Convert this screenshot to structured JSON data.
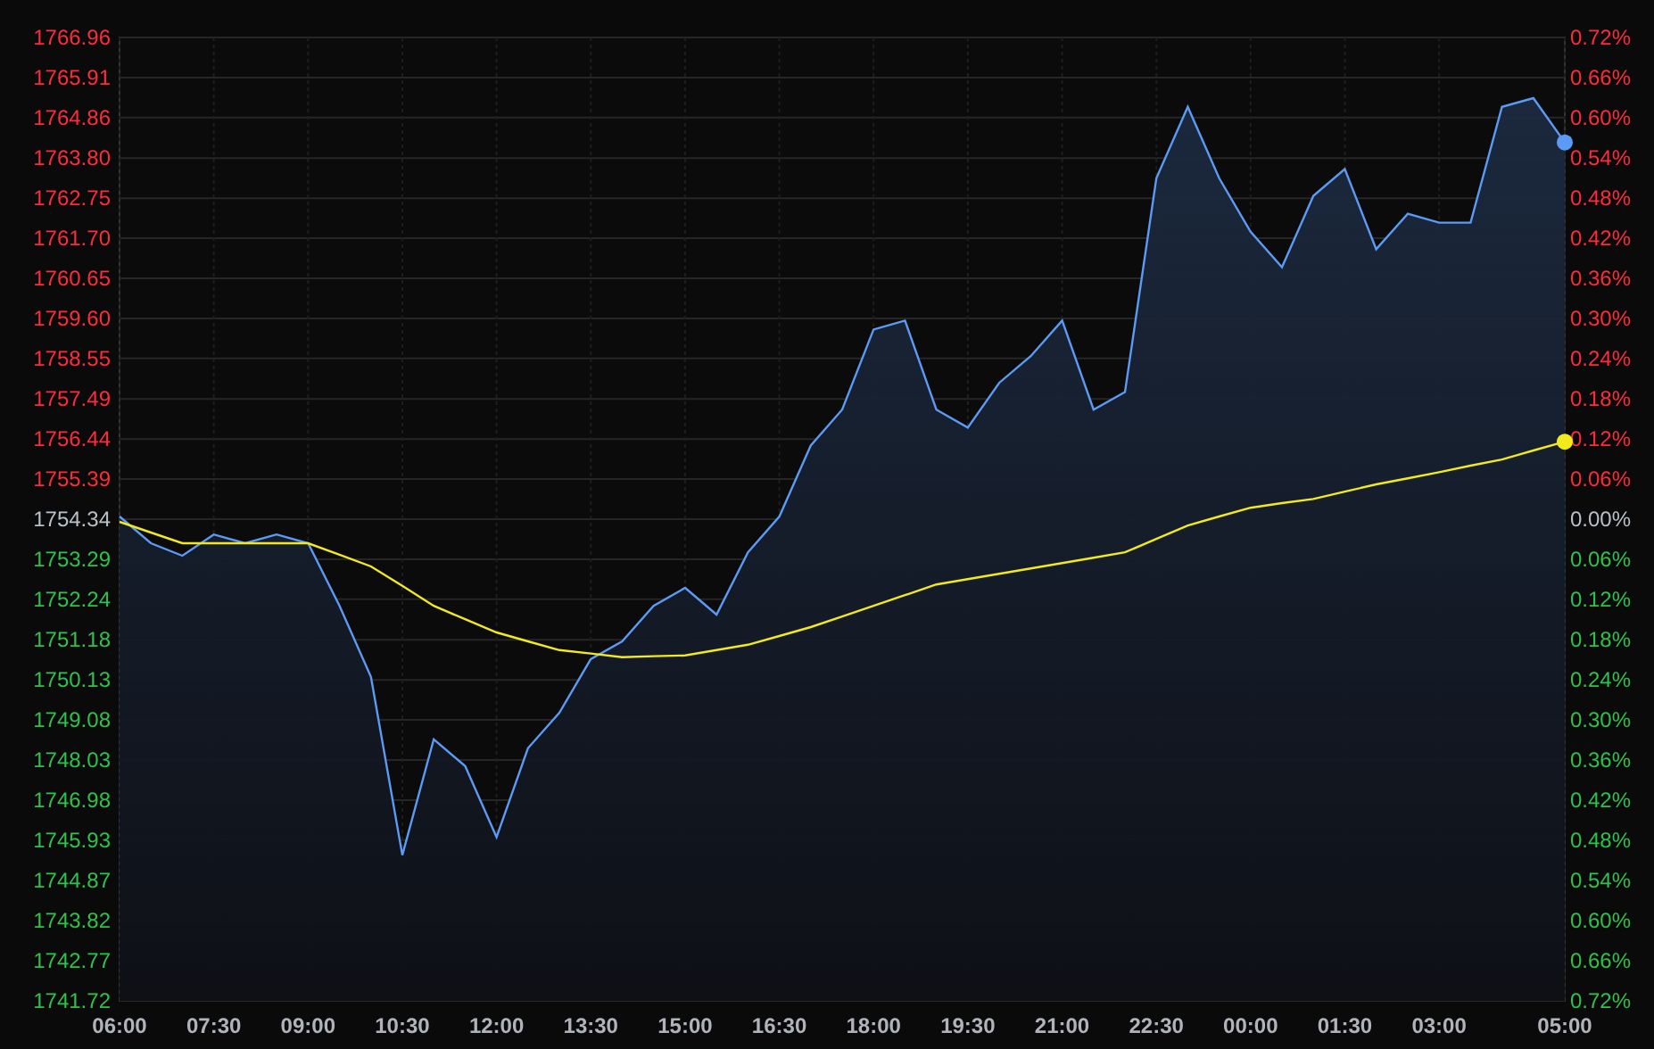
{
  "chart": {
    "chart_data": {
      "type": "area",
      "grid": true,
      "categories": [
        "06:00",
        null,
        null,
        "07:30",
        null,
        null,
        "09:00",
        null,
        null,
        "10:30",
        null,
        null,
        "12:00",
        null,
        null,
        "13:30",
        null,
        null,
        "15:00",
        null,
        null,
        "16:30",
        null,
        null,
        "18:00",
        null,
        null,
        "19:30",
        null,
        null,
        "21:00",
        null,
        null,
        "22:30",
        null,
        null,
        "00:00",
        null,
        null,
        "01:30",
        null,
        null,
        "03:00",
        null,
        null,
        null,
        "05:00"
      ],
      "series": [
        {
          "type": "area",
          "color": "#5b9bf5",
          "values": [
            1754.41,
            1753.71,
            1753.38,
            1753.94,
            1753.71,
            1753.94,
            1753.71,
            1752.07,
            1750.21,
            1745.54,
            1748.57,
            1747.87,
            1746.01,
            1748.34,
            1749.27,
            1750.67,
            1751.14,
            1752.07,
            1752.54,
            1751.84,
            1753.47,
            1754.41,
            1756.27,
            1757.21,
            1759.31,
            1759.54,
            1757.21,
            1756.74,
            1757.91,
            1758.61,
            1759.54,
            1757.21,
            1757.67,
            1763.27,
            1765.14,
            1763.27,
            1761.87,
            1760.94,
            1762.81,
            1763.51,
            1761.41,
            1762.34,
            1762.11,
            1762.11,
            1765.14,
            1765.37,
            1764.21
          ]
        },
        {
          "type": "line",
          "color": "#f2ea1c",
          "values": [
            1754.27,
            1753.99,
            1753.71,
            1753.71,
            1753.71,
            1753.71,
            1753.71,
            1753.41,
            1753.1,
            1752.59,
            1752.07,
            1751.72,
            1751.37,
            1751.14,
            1750.91,
            1750.82,
            1750.72,
            1750.75,
            1750.77,
            1750.91,
            1751.05,
            1751.28,
            1751.51,
            1751.79,
            1752.07,
            1752.35,
            1752.63,
            1752.77,
            1752.91,
            1753.05,
            1753.19,
            1753.33,
            1753.47,
            1753.82,
            1754.17,
            1754.41,
            1754.64,
            1754.76,
            1754.87,
            1755.06,
            1755.25,
            1755.41,
            1755.57,
            1755.74,
            1755.9,
            1756.14,
            1756.37
          ]
        }
      ],
      "ylim": [
        1741.72,
        1766.96
      ],
      "yticks": [
        {
          "value": 1766.96,
          "label": "1766.96"
        },
        {
          "value": 1765.91,
          "label": "1765.91"
        },
        {
          "value": 1764.86,
          "label": "1764.86"
        },
        {
          "value": 1763.8,
          "label": "1763.80"
        },
        {
          "value": 1762.75,
          "label": "1762.75"
        },
        {
          "value": 1761.7,
          "label": "1761.70"
        },
        {
          "value": 1760.65,
          "label": "1760.65"
        },
        {
          "value": 1759.6,
          "label": "1759.60"
        },
        {
          "value": 1758.55,
          "label": "1758.55"
        },
        {
          "value": 1757.49,
          "label": "1757.49"
        },
        {
          "value": 1756.44,
          "label": "1756.44"
        },
        {
          "value": 1755.39,
          "label": "1755.39"
        },
        {
          "value": 1754.34,
          "label": "1754.34"
        },
        {
          "value": 1753.29,
          "label": "1753.29"
        },
        {
          "value": 1752.24,
          "label": "1752.24"
        },
        {
          "value": 1751.18,
          "label": "1751.18"
        },
        {
          "value": 1750.13,
          "label": "1750.13"
        },
        {
          "value": 1749.08,
          "label": "1749.08"
        },
        {
          "value": 1748.03,
          "label": "1748.03"
        },
        {
          "value": 1746.98,
          "label": "1746.98"
        },
        {
          "value": 1745.93,
          "label": "1745.93"
        },
        {
          "value": 1744.87,
          "label": "1744.87"
        },
        {
          "value": 1743.82,
          "label": "1743.82"
        },
        {
          "value": 1742.77,
          "label": "1742.77"
        },
        {
          "value": 1741.72,
          "label": "1741.72"
        }
      ]
    },
    "right_axis_labels": [
      {
        "label": "0.72%",
        "color": "#ff2b3a"
      },
      {
        "label": "0.66%",
        "color": "#ff2b3a"
      },
      {
        "label": "0.60%",
        "color": "#ff2b3a"
      },
      {
        "label": "0.54%",
        "color": "#ff2b3a"
      },
      {
        "label": "0.48%",
        "color": "#ff2b3a"
      },
      {
        "label": "0.42%",
        "color": "#ff2b3a"
      },
      {
        "label": "0.36%",
        "color": "#ff2b3a"
      },
      {
        "label": "0.30%",
        "color": "#ff2b3a"
      },
      {
        "label": "0.24%",
        "color": "#ff2b3a"
      },
      {
        "label": "0.18%",
        "color": "#ff2b3a"
      },
      {
        "label": "0.12%",
        "color": "#ff2b3a"
      },
      {
        "label": "0.06%",
        "color": "#ff2b3a"
      },
      {
        "label": "0.00%",
        "color": "#b8c0c8"
      },
      {
        "label": "0.06%",
        "color": "#2ec24a"
      },
      {
        "label": "0.12%",
        "color": "#2ec24a"
      },
      {
        "label": "0.18%",
        "color": "#2ec24a"
      },
      {
        "label": "0.24%",
        "color": "#2ec24a"
      },
      {
        "label": "0.30%",
        "color": "#2ec24a"
      },
      {
        "label": "0.36%",
        "color": "#2ec24a"
      },
      {
        "label": "0.42%",
        "color": "#2ec24a"
      },
      {
        "label": "0.48%",
        "color": "#2ec24a"
      },
      {
        "label": "0.54%",
        "color": "#2ec24a"
      },
      {
        "label": "0.60%",
        "color": "#2ec24a"
      },
      {
        "label": "0.66%",
        "color": "#2ec24a"
      },
      {
        "label": "0.72%",
        "color": "#2ec24a"
      }
    ]
  }
}
